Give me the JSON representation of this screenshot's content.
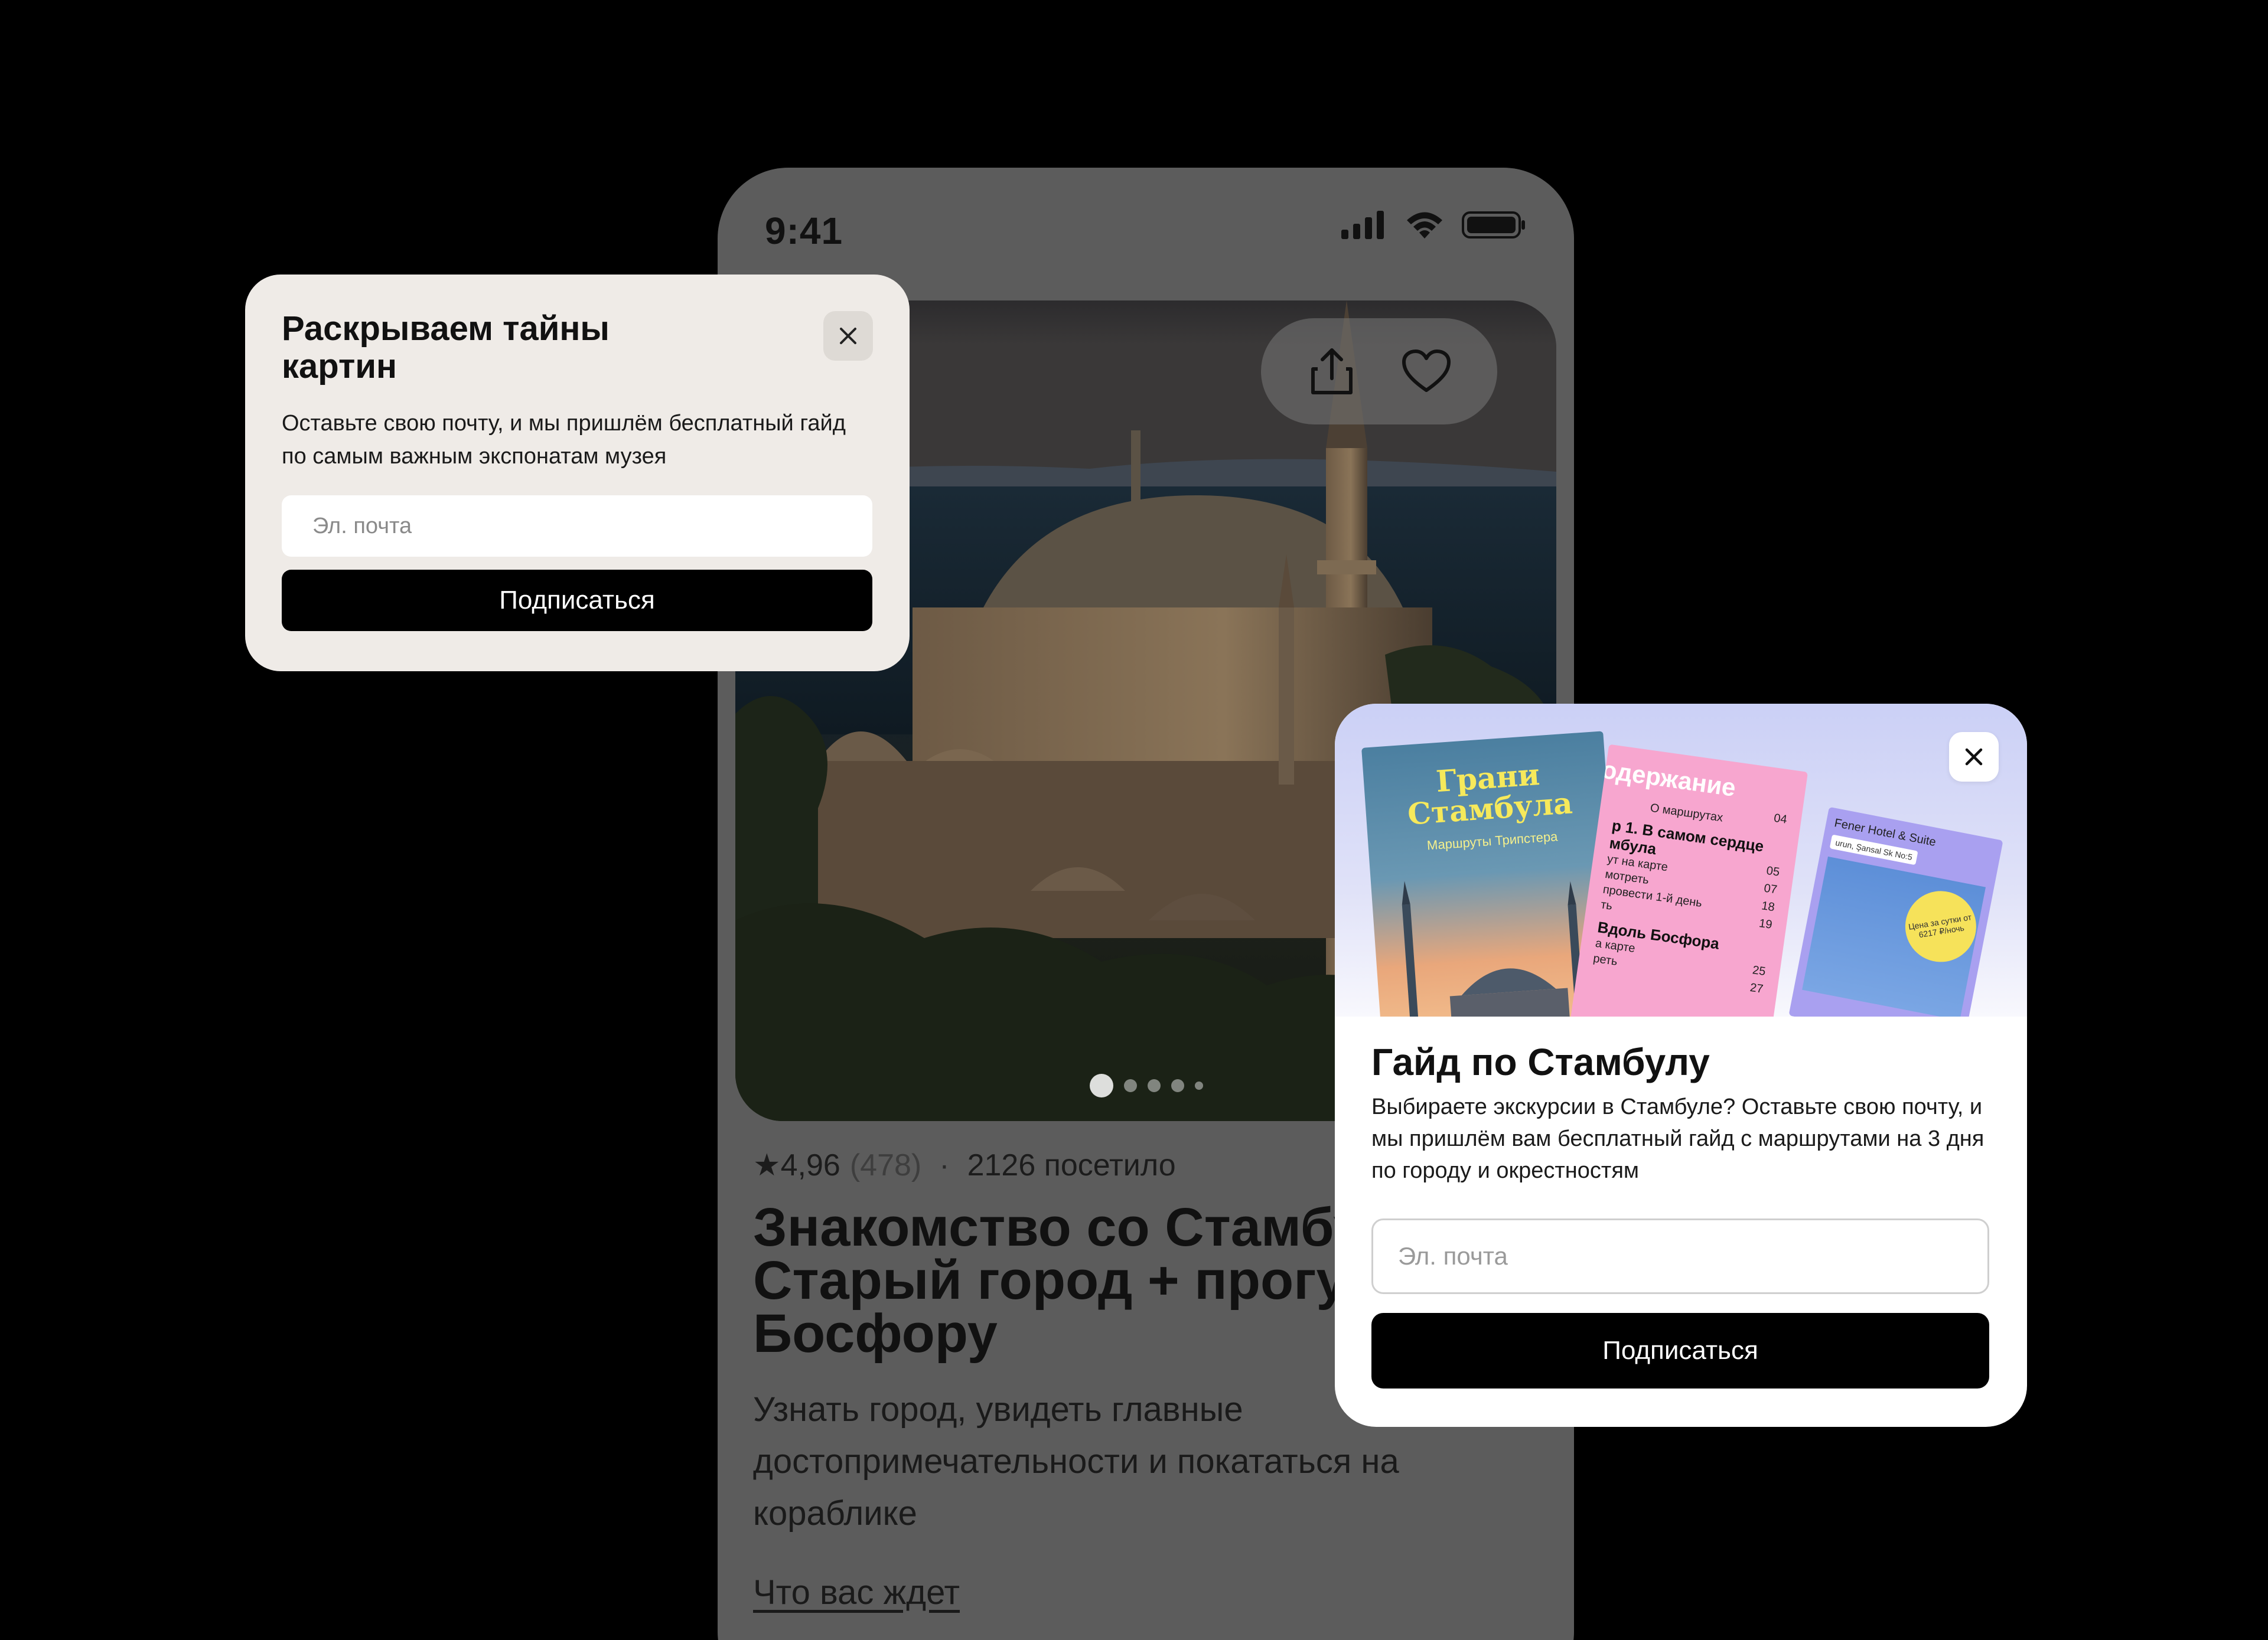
{
  "status_bar": {
    "time": "9:41"
  },
  "tour": {
    "rating": "★4,96",
    "reviews_count": "(478)",
    "separator": "·",
    "visited": "2126 посетило",
    "title": "Знакомство со Стамбулом: Старый город + прогулка по Босфору",
    "description": "Узнать город, увидеть главные достопримечательности и покататься на кораблике",
    "section_link": "Что вас ждет",
    "gallery": {
      "total": 5,
      "active": 0
    }
  },
  "popup_museum": {
    "title": "Раскрываем тайны картин",
    "text": "Оставьте свою почту, и мы пришлём бесплатный гайд по самым важным экспонатам музея",
    "email_placeholder": "Эл. почта",
    "button": "Подписаться"
  },
  "popup_istanbul": {
    "title": "Гайд по Стамбулу",
    "text": "Выбираете экскурсии в Стамбуле? Оставьте свою почту, и мы пришлём вам бесплатный гайд с маршрутами на 3 дня по городу и окрестностям",
    "email_placeholder": "Эл. почта",
    "button": "Подписаться",
    "banner": {
      "cover_title": "Грани Стамбула",
      "cover_subtitle": "Маршруты Трипстера",
      "toc_heading": "одержание",
      "toc_intro": "О маршрутах",
      "toc_day1": "р 1. В самом сердце мбула",
      "toc_lines": [
        "ут на карте",
        "мотреть",
        "провести 1-й день",
        "ть"
      ],
      "toc_day2": "Вдоль Босфора",
      "toc_lines2": [
        "а карте",
        "реть"
      ],
      "toc_numbers": [
        "04",
        "05",
        "07",
        "18",
        "19",
        "25",
        "27"
      ],
      "hotel_name": "Fener Hotel & Suite",
      "hotel_address": "urun, Şansal Sk No:5",
      "hotel_badge": "Цена за сутки от 6217 ₽/ночь"
    }
  },
  "colors": {
    "background": "#000000",
    "phone_dim": "#5c5c5c",
    "popup_museum_bg": "#efebe7",
    "button_bg": "#000000",
    "banner_top": "#cbd0f6"
  }
}
